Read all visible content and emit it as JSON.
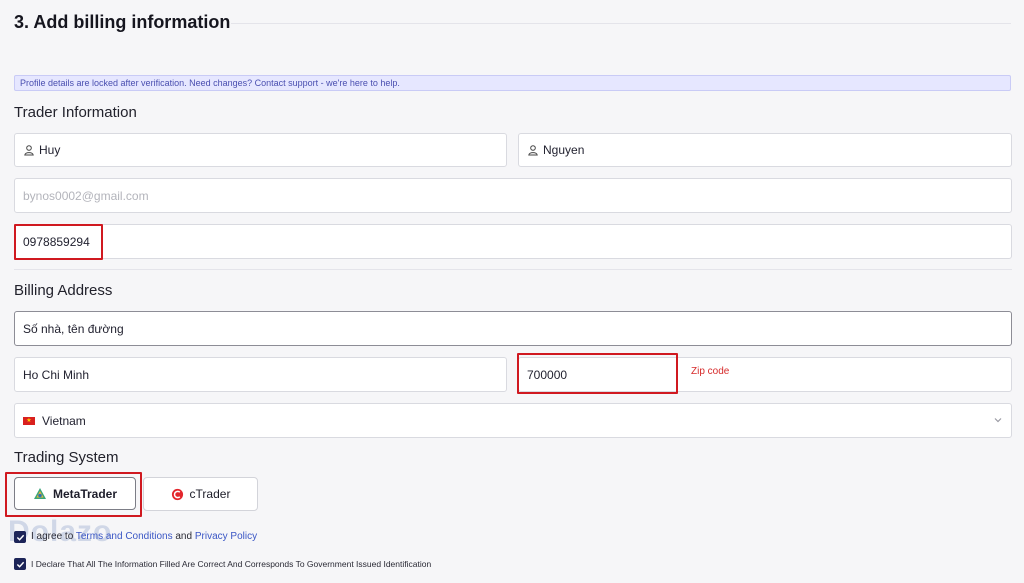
{
  "section": {
    "title": "3. Add billing information"
  },
  "notice": {
    "text": "Profile details are locked after verification. Need changes? Contact support - we're here to help."
  },
  "trader": {
    "title": "Trader Information",
    "first_name": "Huy",
    "last_name": "Nguyen",
    "email_placeholder": "bynos0002@gmail.com",
    "phone": "0978859294"
  },
  "billing": {
    "title": "Billing Address",
    "street": "Số nhà, tên đường",
    "city": "Ho Chi Minh",
    "zip": "700000",
    "zip_hint": "Zip code",
    "country": "Vietnam"
  },
  "trading": {
    "title": "Trading System",
    "options": [
      "MetaTrader",
      "cTrader"
    ],
    "selected": "MetaTrader"
  },
  "legal": {
    "agree_prefix": "I agree to",
    "terms": "Terms and Conditions",
    "and": "and",
    "privacy": "Privacy Policy",
    "declare": "I Declare That All The Information Filled Are Correct And Corresponds To Government Issued Identification"
  },
  "watermark": {
    "text": "Dolazo"
  },
  "colors": {
    "accent": "#1c2458",
    "highlight_red": "#d01920",
    "link": "#3a56c5",
    "notice_bg": "#e6e7ff"
  },
  "icons": [
    "user-icon",
    "vietnam-flag-icon",
    "chevron-down-icon",
    "metatrader-logo-icon",
    "ctrader-logo-icon",
    "checkbox-checked-icon"
  ]
}
